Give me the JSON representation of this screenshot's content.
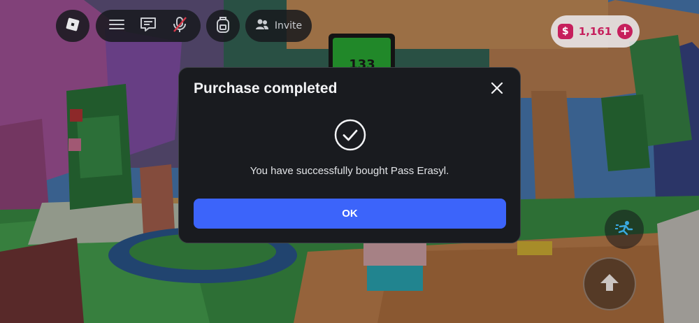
{
  "topbar": {
    "invite_label": "Invite",
    "currency_amount": "1,161",
    "currency_symbol": "$",
    "currency_add": "+"
  },
  "scene": {
    "sign_text": "133"
  },
  "dialog": {
    "title": "Purchase completed",
    "message": "You have successfully bought Pass Erasyl.",
    "ok_label": "OK"
  },
  "colors": {
    "primary_button": "#3c64fa",
    "currency_accent": "#c61f5c",
    "dialog_bg": "#191b1f"
  },
  "icons": {
    "roblox": "roblox-logo-icon",
    "menu": "hamburger-icon",
    "chat": "chat-icon",
    "mic": "mic-muted-icon",
    "backpack": "backpack-icon",
    "invite": "people-icon",
    "close": "close-icon",
    "success": "check-circle-icon",
    "sprint": "sprint-icon",
    "jump": "jump-arrow-icon"
  }
}
